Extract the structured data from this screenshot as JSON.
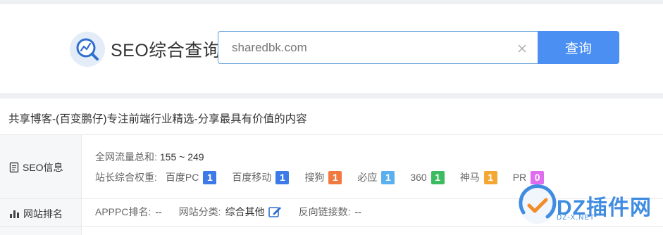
{
  "header": {
    "logo_text": "SEO综合查询",
    "search": {
      "value": "sharedbk.com",
      "button_label": "查询"
    }
  },
  "site_title": "共享博客-(百变鹏仔)专注前端行业精选-分享最具有价值的内容",
  "seo_info": {
    "label": "SEO信息",
    "traffic_label": "全网流量总和:",
    "traffic_value": "155 ~ 249",
    "weight_label": "站长综合权重:",
    "weights": [
      {
        "name": "百度PC",
        "value": "1",
        "color": "#3d7ae8"
      },
      {
        "name": "百度移动",
        "value": "1",
        "color": "#3d7ae8"
      },
      {
        "name": "搜狗",
        "value": "1",
        "color": "#f2793f"
      },
      {
        "name": "必应",
        "value": "1",
        "color": "#5ab0ee"
      },
      {
        "name": "360",
        "value": "1",
        "color": "#3dbb61"
      },
      {
        "name": "神马",
        "value": "1",
        "color": "#f5a733"
      },
      {
        "name": "PR",
        "value": "0",
        "color": "#e06cf0"
      }
    ]
  },
  "site_rank": {
    "label": "网站排名",
    "items": [
      {
        "key": "APPPC排名:",
        "value": "--"
      },
      {
        "key": "网站分类:",
        "value": "综合其他"
      },
      {
        "key": "反向链接数:",
        "value": "--"
      }
    ]
  },
  "watermark": {
    "text": "DZ插件网",
    "sub": "DZ-X.NET"
  }
}
